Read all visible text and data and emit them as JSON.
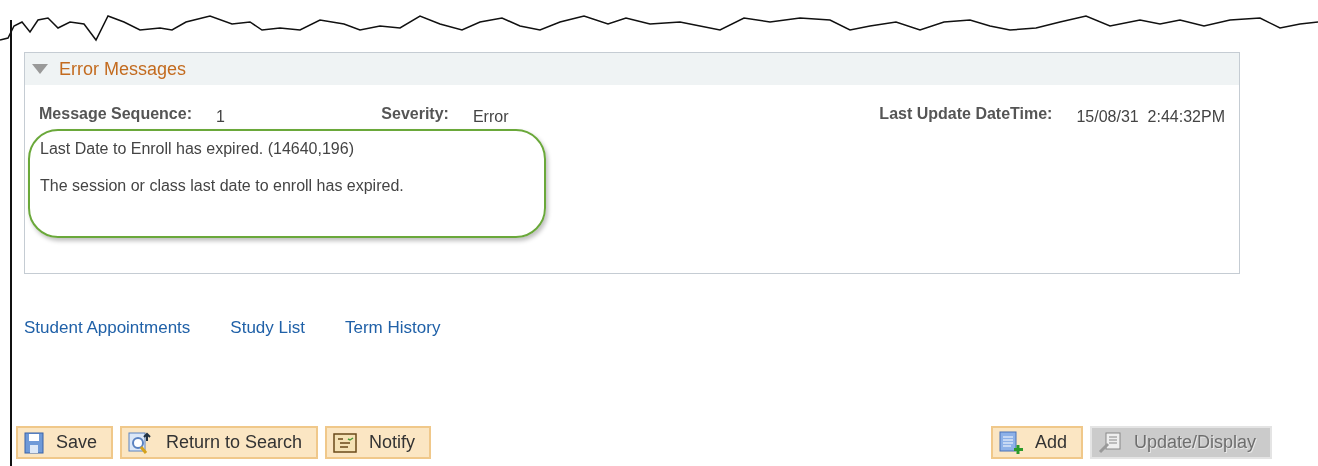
{
  "section": {
    "title": "Error Messages",
    "expanded": true,
    "fields": [
      {
        "label": "Message Sequence:",
        "value": "1"
      },
      {
        "label": "Severity:",
        "value": "Error"
      },
      {
        "label": "Last Update DateTime:",
        "value": "15/08/31  2:44:32PM"
      }
    ],
    "messages": [
      "Last Date to Enroll has expired. (14640,196)",
      "The session or class last date to enroll has expired."
    ]
  },
  "links": [
    "Student Appointments",
    "Study List",
    "Term History"
  ],
  "left_buttons": [
    {
      "label": "Save",
      "kind": "save",
      "disabled": false
    },
    {
      "label": "Return to Search",
      "kind": "search",
      "disabled": false
    },
    {
      "label": "Notify",
      "kind": "notify",
      "disabled": false
    }
  ],
  "right_buttons": [
    {
      "label": "Add",
      "kind": "add",
      "disabled": false
    },
    {
      "label": "Update/Display",
      "kind": "update",
      "disabled": true
    }
  ]
}
